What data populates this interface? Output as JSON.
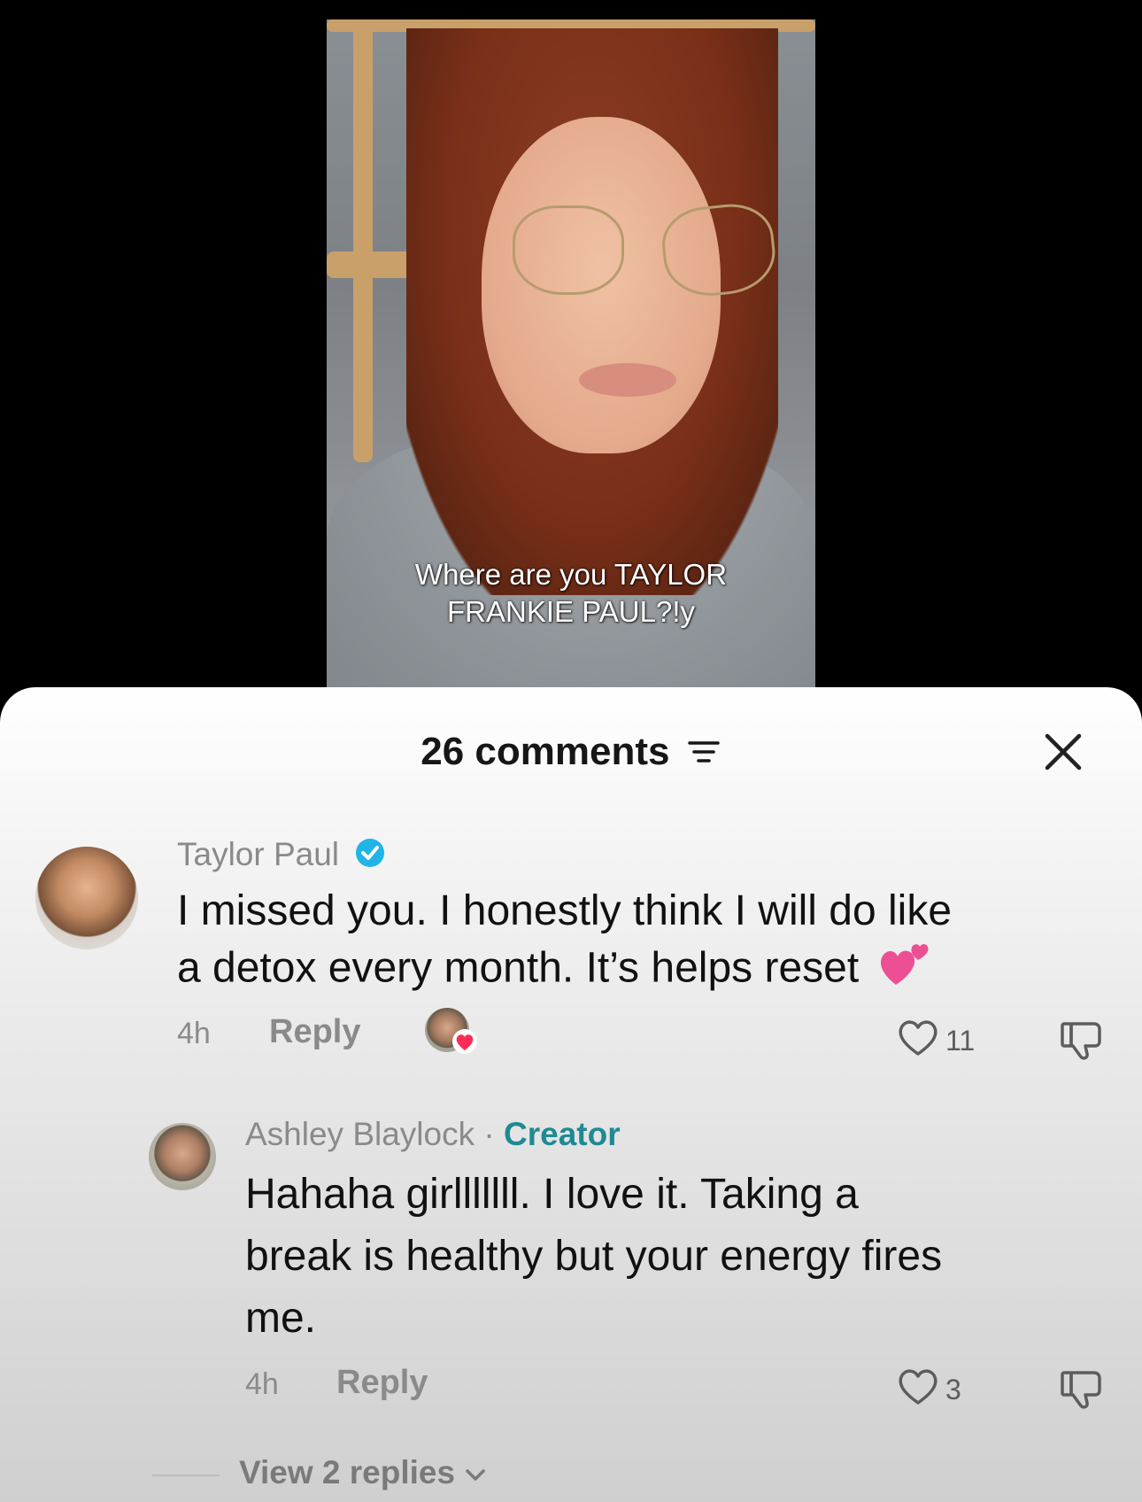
{
  "video": {
    "caption_line1": "Where are you TAYLOR",
    "caption_line2": "FRANKIE PAUL?!y"
  },
  "sheet": {
    "comments_count": "26 comments",
    "icons": {
      "filter": "filter-lines-icon",
      "close": "close-x-icon"
    }
  },
  "comments": [
    {
      "author": "Taylor Paul",
      "verified": true,
      "text_line1": "I missed you. I honestly think I will do like",
      "text_line2": "a detox every month. It’s helps reset",
      "emoji": "two-hearts",
      "time": "4h",
      "reply_label": "Reply",
      "likes": "11",
      "liked_by_creator": true
    },
    {
      "author": "Ashley Blaylock",
      "separator": "·",
      "tag": "Creator",
      "text_line1": "Hahaha girlllllll. I love it. Taking a",
      "text_line2": "break is healthy but your energy fires",
      "text_line3": "me.",
      "time": "4h",
      "reply_label": "Reply",
      "likes": "3",
      "view_replies": "View 2 replies"
    }
  ],
  "colors": {
    "creator_tag": "#1f8a94",
    "verified_badge": "#20b5e6",
    "heart_badge": "#fe2c55",
    "emoji_pink": "#ec4f93"
  }
}
